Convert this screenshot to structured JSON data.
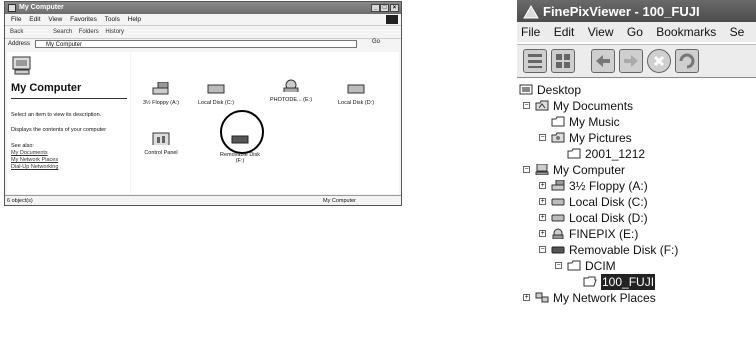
{
  "left_window": {
    "title": "My Computer",
    "menu": [
      "File",
      "Edit",
      "View",
      "Favorites",
      "Tools",
      "Help"
    ],
    "toolbar": [
      "Back",
      "Search",
      "Folders",
      "History"
    ],
    "address_label": "Address",
    "address_value": "My Computer",
    "go_label": "Go",
    "panel_title": "My Computer",
    "panel_desc": "Select an item to view its description.",
    "panel_desc2": "Displays the contents of your computer",
    "see_also": "See also:",
    "links": [
      "My Documents",
      "My Network Places",
      "Dial-Up Networking"
    ],
    "drives": [
      {
        "label": "3½ Floppy (A:)",
        "icon": "floppy-icon"
      },
      {
        "label": "Local Disk (C:)",
        "icon": "harddisk-icon"
      },
      {
        "label": "PHOTODE... (E:)",
        "icon": "camera-drive-icon"
      },
      {
        "label": "Local Disk (D:)",
        "icon": "harddisk-icon"
      },
      {
        "label": "Control Panel",
        "icon": "control-panel-icon"
      },
      {
        "label": "Removable Disk (F:)",
        "icon": "removable-disk-icon"
      }
    ],
    "status_left": "6 object(s)",
    "status_right": "My Computer"
  },
  "right_window": {
    "title": "FinePixViewer - 100_FUJI",
    "menu": [
      "File",
      "Edit",
      "View",
      "Go",
      "Bookmarks",
      "Se"
    ],
    "toolbar_icons": [
      "view-list-icon",
      "view-thumbnail-icon",
      "back-arrow-icon",
      "forward-arrow-icon",
      "stop-icon",
      "refresh-icon"
    ],
    "tree": [
      {
        "label": "Desktop",
        "icon": "desktop-icon",
        "level": 0,
        "expander": ""
      },
      {
        "label": "My Documents",
        "icon": "documents-folder-icon",
        "level": 1,
        "expander": "−"
      },
      {
        "label": "My Music",
        "icon": "folder-icon",
        "level": 2,
        "expander": ""
      },
      {
        "label": "My Pictures",
        "icon": "pictures-folder-icon",
        "level": 2,
        "expander": "−"
      },
      {
        "label": "2001_1212",
        "icon": "folder-icon",
        "level": 3,
        "expander": ""
      },
      {
        "label": "My Computer",
        "icon": "computer-icon",
        "level": 1,
        "expander": "−"
      },
      {
        "label": "3½ Floppy (A:)",
        "icon": "floppy-icon",
        "level": 2,
        "expander": "+"
      },
      {
        "label": "Local Disk (C:)",
        "icon": "harddisk-icon",
        "level": 2,
        "expander": "+"
      },
      {
        "label": "Local Disk (D:)",
        "icon": "harddisk-icon",
        "level": 2,
        "expander": "+"
      },
      {
        "label": "FINEPIX (E:)",
        "icon": "camera-drive-icon",
        "level": 2,
        "expander": "+"
      },
      {
        "label": "Removable Disk (F:)",
        "icon": "removable-disk-icon",
        "level": 2,
        "expander": "−"
      },
      {
        "label": "DCIM",
        "icon": "folder-icon",
        "level": 3,
        "expander": "−"
      },
      {
        "label": "100_FUJI",
        "icon": "open-folder-icon",
        "level": 4,
        "expander": "",
        "selected": true
      },
      {
        "label": "My Network Places",
        "icon": "network-icon",
        "level": 1,
        "expander": "+"
      }
    ]
  }
}
